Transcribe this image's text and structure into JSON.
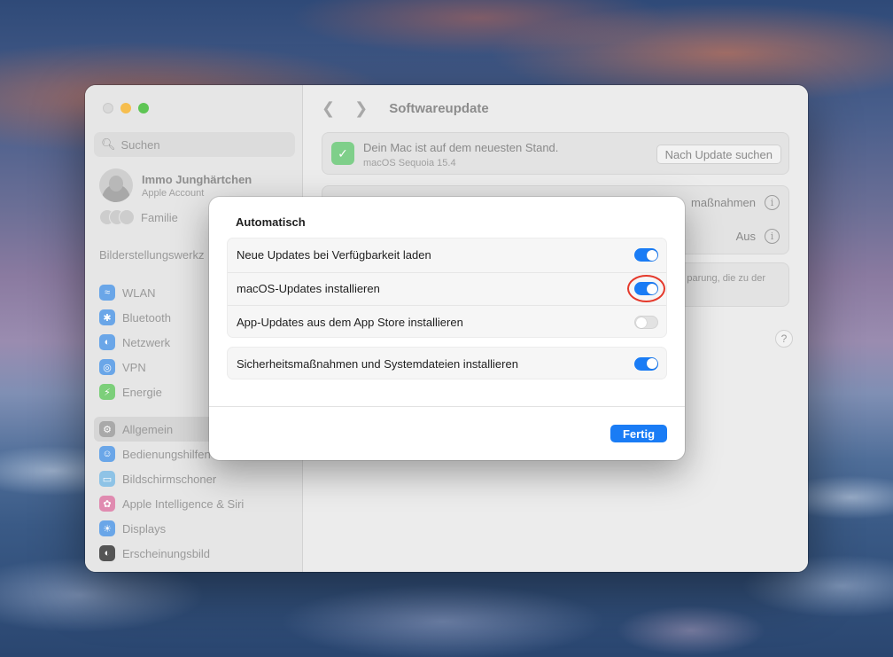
{
  "window": {
    "title": "Softwareupdate",
    "back_icon": "chevron-left-icon",
    "forward_icon": "chevron-right-icon"
  },
  "sidebar": {
    "search_placeholder": "Suchen",
    "account": {
      "name": "Immo Junghärtchen",
      "subtitle": "Apple Account"
    },
    "family_label": "Familie",
    "section_label": "Bilderstellungswerkz",
    "items": [
      {
        "label": "WLAN",
        "icon": "wifi-icon",
        "color": "#6aa6e8"
      },
      {
        "label": "Bluetooth",
        "icon": "bluetooth-icon",
        "color": "#6aa6e8"
      },
      {
        "label": "Netzwerk",
        "icon": "globe-icon",
        "color": "#6aa6e8"
      },
      {
        "label": "VPN",
        "icon": "vpn-globe-icon",
        "color": "#6aa6e8"
      },
      {
        "label": "Energie",
        "icon": "bolt-icon",
        "color": "#7ccf7a"
      },
      {
        "label": "Allgemein",
        "icon": "gear-icon",
        "color": "#a9a9a9"
      },
      {
        "label": "Bedienungshilfen",
        "icon": "accessibility-icon",
        "color": "#6aa6e8"
      },
      {
        "label": "Bildschirmschoner",
        "icon": "screensaver-icon",
        "color": "#8ec3e6"
      },
      {
        "label": "Apple Intelligence & Siri",
        "icon": "siri-icon",
        "color": "#e08bb0"
      },
      {
        "label": "Displays",
        "icon": "sun-icon",
        "color": "#6aa6e8"
      },
      {
        "label": "Erscheinungsbild",
        "icon": "appearance-icon",
        "color": "#555555"
      }
    ]
  },
  "main": {
    "status": {
      "title": "Dein Mac ist auf dem neuesten Stand.",
      "subtitle": "macOS Sequoia 15.4",
      "check_button": "Nach Update suchen"
    },
    "info_row1": "maßnahmen",
    "info_row2": "Aus",
    "note": "parung, die zu der",
    "help": "?"
  },
  "sheet": {
    "heading": "Automatisch",
    "group1": [
      {
        "label": "Neue Updates bei Verfügbarkeit laden",
        "on": true
      },
      {
        "label": "macOS-Updates installieren",
        "on": true,
        "highlighted": true
      },
      {
        "label": "App-Updates aus dem App Store installieren",
        "on": false
      }
    ],
    "group2": [
      {
        "label": "Sicherheitsmaßnahmen und Systemdateien installieren",
        "on": true
      }
    ],
    "done_button": "Fertig"
  },
  "colors": {
    "accent": "#1a7cf5",
    "highlight_ring": "#e5392b",
    "status_ok": "#7fcf8a"
  }
}
